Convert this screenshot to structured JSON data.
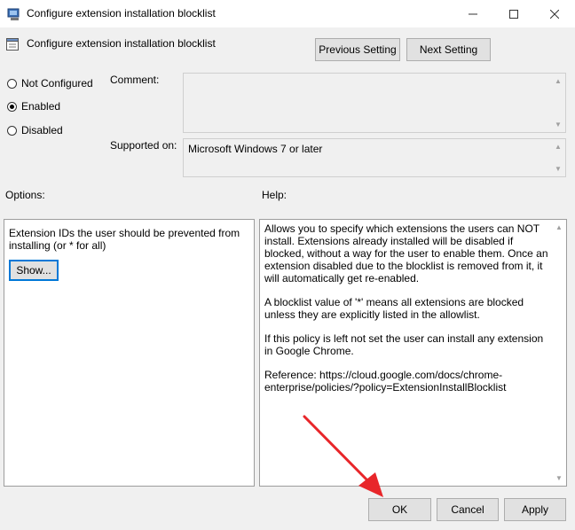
{
  "window": {
    "title": "Configure extension installation blocklist"
  },
  "header": {
    "title": "Configure extension installation blocklist"
  },
  "nav": {
    "previous": "Previous Setting",
    "next": "Next Setting"
  },
  "state": {
    "options": [
      "Not Configured",
      "Enabled",
      "Disabled"
    ],
    "selected": "Enabled"
  },
  "comment": {
    "label": "Comment:",
    "value": ""
  },
  "supported": {
    "label": "Supported on:",
    "value": "Microsoft Windows 7 or later"
  },
  "options_panel": {
    "label": "Options:",
    "description": "Extension IDs the user should be prevented from installing (or * for all)",
    "show_button": "Show..."
  },
  "help_panel": {
    "label": "Help:",
    "paragraphs": [
      "Allows you to specify which extensions the users can NOT install. Extensions already installed will be disabled if blocked, without a way for the user to enable them. Once an extension disabled due to the blocklist is removed from it, it will automatically get re-enabled.",
      "A blocklist value of '*' means all extensions are blocked unless they are explicitly listed in the allowlist.",
      "If this policy is left not set the user can install any extension in Google Chrome.",
      "Reference: https://cloud.google.com/docs/chrome-enterprise/policies/?policy=ExtensionInstallBlocklist"
    ]
  },
  "footer": {
    "ok": "OK",
    "cancel": "Cancel",
    "apply": "Apply"
  },
  "colors": {
    "annotation_arrow": "#e8262a",
    "focus": "#0078d7"
  }
}
